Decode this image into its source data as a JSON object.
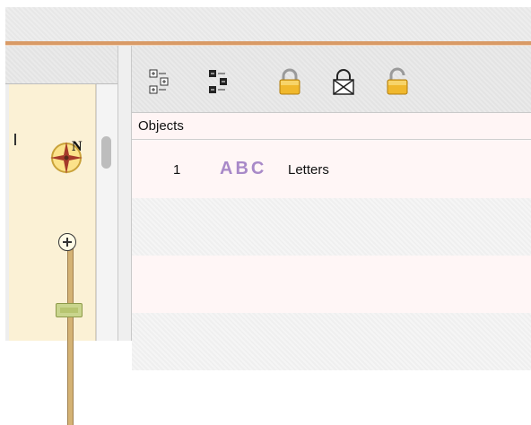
{
  "objects_panel": {
    "header": "Objects",
    "rows": [
      {
        "index": "1",
        "icon_text": "ABC",
        "name": "Letters"
      }
    ]
  },
  "map": {
    "north_label": "N"
  },
  "toolbar": {
    "buttons": [
      {
        "icon": "expand-all-icon"
      },
      {
        "icon": "collapse-all-icon"
      },
      {
        "icon": "lock-closed-icon"
      },
      {
        "icon": "lock-disabled-icon"
      },
      {
        "icon": "lock-open-icon"
      }
    ]
  },
  "colors": {
    "objects_background": "#fff8f8",
    "abc_icon": "#a889c8",
    "lock_gold": "#f0b82d",
    "accent_rule": "#d99a66",
    "map_background": "#fbf1d5"
  }
}
